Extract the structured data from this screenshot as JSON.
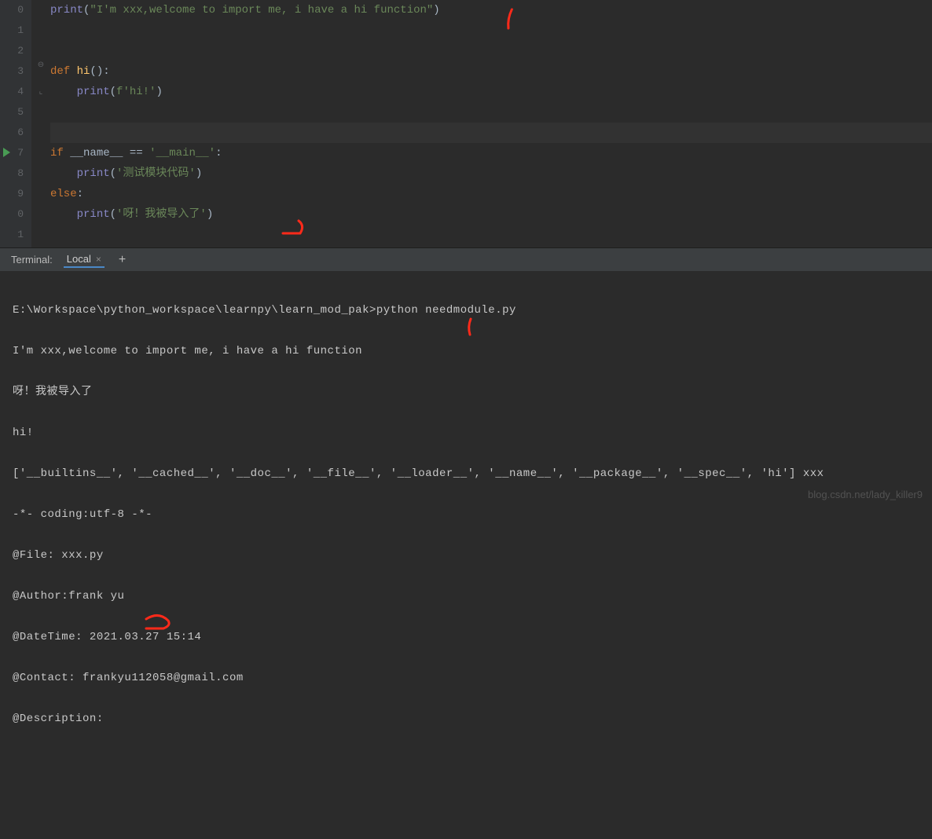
{
  "editor": {
    "line_numbers": [
      "0",
      "1",
      "2",
      "3",
      "4",
      "5",
      "6",
      "7",
      "8",
      "9",
      "0",
      "1"
    ],
    "lines": {
      "l0_print": "print",
      "l0_open": "(",
      "l0_str": "\"I'm xxx,welcome to import me, i have a hi function\"",
      "l0_close": ")",
      "l3_def": "def ",
      "l3_fn": "hi",
      "l3_rest": "():",
      "l4_print": "print",
      "l4_open": "(",
      "l4_f": "f",
      "l4_str": "'hi!'",
      "l4_close": ")",
      "l7_if": "if ",
      "l7_name": "__name__ ",
      "l7_eq": "== ",
      "l7_main": "'__main__'",
      "l7_colon": ":",
      "l8_print": "print",
      "l8_open": "(",
      "l8_str": "'测试模块代码'",
      "l8_close": ")",
      "l9_else": "else",
      "l9_colon": ":",
      "l10_print": "print",
      "l10_open": "(",
      "l10_str": "'呀！我被导入了'",
      "l10_close": ")"
    },
    "annotations": {
      "a1": "1",
      "a2": "1",
      "a3": "2"
    }
  },
  "terminal": {
    "title": "Terminal:",
    "tab_label": "Local",
    "add_label": "+",
    "lines": [
      "E:\\Workspace\\python_workspace\\learnpy\\learn_mod_pak>python needmodule.py",
      "I'm xxx,welcome to import me, i have a hi function",
      "呀！我被导入了",
      "hi!",
      "['__builtins__', '__cached__', '__doc__', '__file__', '__loader__', '__name__', '__package__', '__spec__', 'hi'] xxx",
      "-*- coding:utf-8 -*-",
      "@File: xxx.py",
      "@Author:frank yu",
      "@DateTime: 2021.03.27 15:14",
      "@Contact: frankyu112058@gmail.com",
      "@Description:"
    ]
  },
  "watermark": "blog.csdn.net/lady_killer9"
}
